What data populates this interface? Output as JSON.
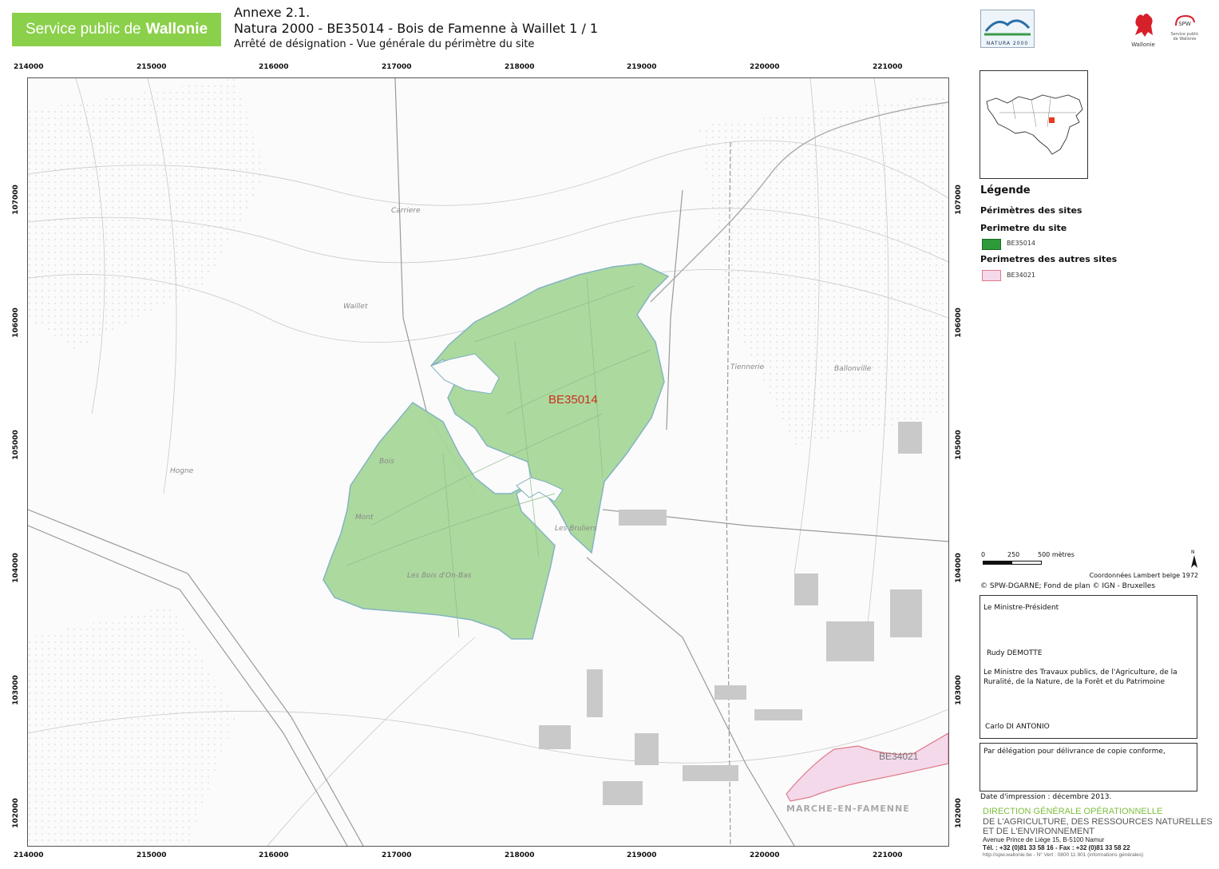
{
  "header": {
    "brand_prefix": "Service public de",
    "brand_name": "Wallonie",
    "line1": "Annexe 2.1.",
    "line2": "Natura 2000 - BE35014 - Bois de Famenne à Waillet  1 / 1",
    "line3": "Arrêté de désignation - Vue générale du périmètre du site"
  },
  "logos": {
    "natura": "NATURA 2000",
    "wallonie": "Wallonie",
    "spw": "SPW",
    "spw_sub": "Service public de Wallonie"
  },
  "map": {
    "x_ticks": [
      "214000",
      "215000",
      "216000",
      "217000",
      "218000",
      "219000",
      "220000",
      "221000"
    ],
    "y_ticks": [
      "107000",
      "106000",
      "105000",
      "104000",
      "103000",
      "102000"
    ],
    "site_label": "BE35014",
    "other_site_label": "BE34021",
    "place_labels": [
      "Waillet",
      "Hogne",
      "Ballonville",
      "Bois",
      "Mont",
      "Les Bois d'On-Bas",
      "MARCHE-EN-FAMENNE",
      "Les Bruliers",
      "Carriere",
      "Tiennerie"
    ],
    "site_color": "#a8d89a",
    "site_border": "#7fb0c0",
    "other_color": "#f3d9ea",
    "other_border": "#e07a8a"
  },
  "legend": {
    "title": "Légende",
    "section": "Périmètres des sites",
    "site_group": "Perimetre du site",
    "site_item": "BE35014",
    "other_group": "Perimetres des autres sites",
    "other_item": "BE34021"
  },
  "scale": {
    "t0": "0",
    "t1": "250",
    "t2": "500 mètres",
    "north": "N",
    "coords": "Coordonnées Lambert belge 1972",
    "credits": "© SPW-DGARNE; Fond de plan © IGN - Bruxelles"
  },
  "signatures": {
    "title1": "Le Ministre-Président",
    "name1": "Rudy DEMOTTE",
    "title2": "Le Ministre des Travaux publics, de l'Agriculture, de la Ruralité, de la Nature, de la Forêt et du Patrimoine",
    "name2": "Carlo DI ANTONIO",
    "delegation": "Par délégation pour délivrance de copie conforme,"
  },
  "footer": {
    "print_date": "Date d'impression : décembre 2013.",
    "dgo1": "DIRECTION GÉNÉRALE OPÉRATIONNELLE",
    "dgo2": "DE L'AGRICULTURE, DES RESSOURCES NATURELLES",
    "dgo3": "ET DE L'ENVIRONNEMENT",
    "address": "Avenue Prince de Liège 15, B-5100 Namur",
    "phone": "Tél. : +32 (0)81 33 58 16 - Fax : +32 (0)81 33 58 22",
    "web": "http://spw.wallonie.be - N° Vert : 0800 11 901 (informations générales)"
  }
}
